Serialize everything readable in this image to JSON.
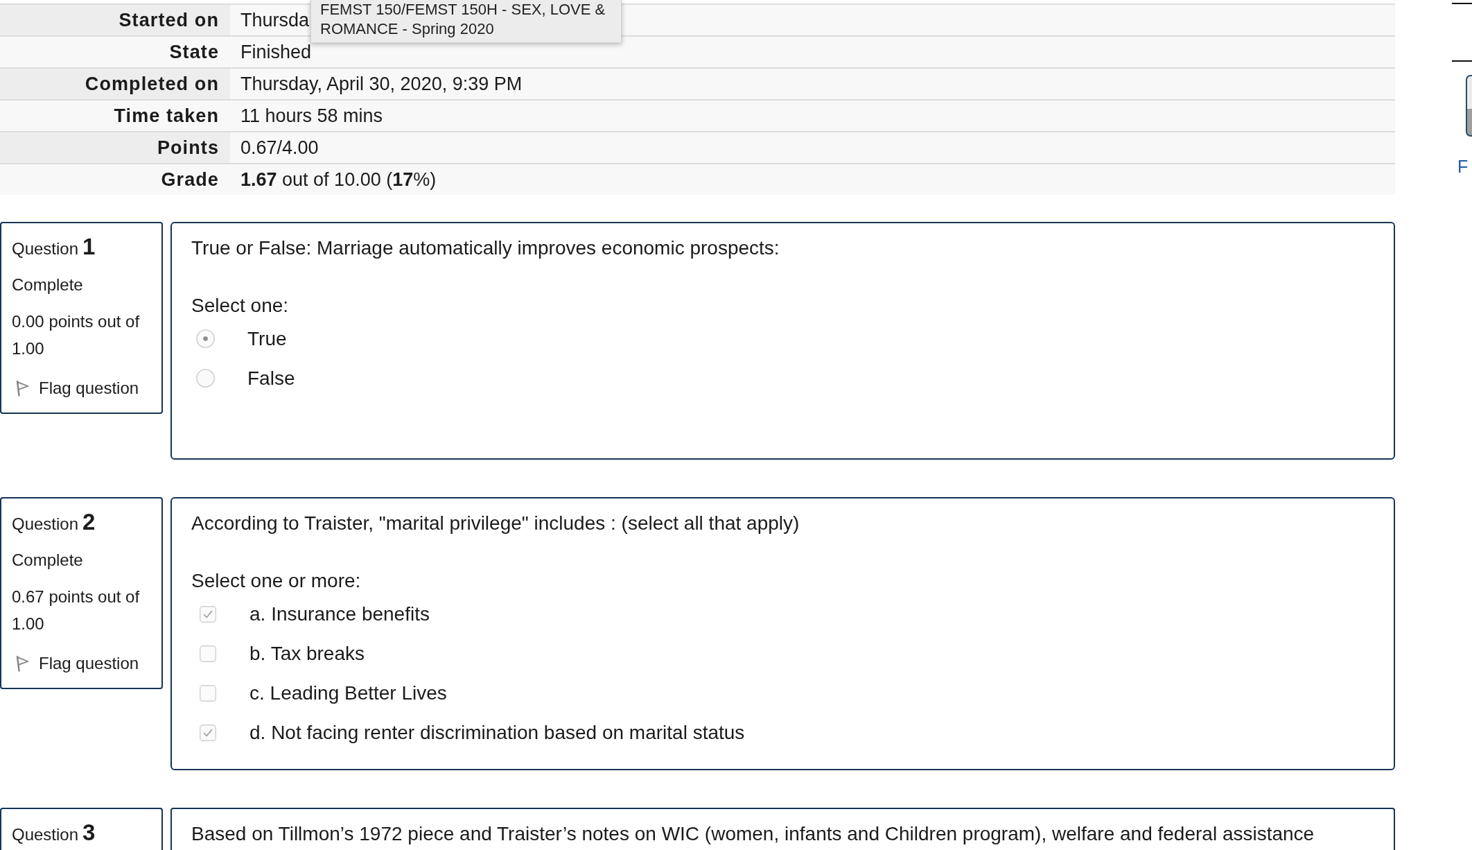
{
  "tooltip": {
    "text": "FEMST 150/FEMST 150H - SEX, LOVE & ROMANCE - Spring 2020"
  },
  "summary": [
    {
      "label": "Started on",
      "value": "Thursda"
    },
    {
      "label": "State",
      "value": "Finished"
    },
    {
      "label": "Completed on",
      "value": "Thursday, April 30, 2020, 9:39 PM"
    },
    {
      "label": "Time taken",
      "value": "11 hours 58 mins"
    },
    {
      "label": "Points",
      "value": "0.67/4.00"
    },
    {
      "label": "Grade",
      "value": "**1.67** out of 10.00 (**17**%)"
    }
  ],
  "questions": [
    {
      "label": "Question",
      "number": "1",
      "state": "Complete",
      "grade": "0.00 points out of 1.00",
      "flag": "Flag question",
      "text": "True or False: Marriage automatically improves economic prospects:",
      "prompt": "Select one:",
      "kind": "radio",
      "options": [
        {
          "label": "True",
          "selected": true
        },
        {
          "label": "False",
          "selected": false
        }
      ]
    },
    {
      "label": "Question",
      "number": "2",
      "state": "Complete",
      "grade": "0.67 points out of 1.00",
      "flag": "Flag question",
      "text": "According to Traister, \"marital privilege\" includes : (select all that apply)",
      "prompt": "Select one or more:",
      "kind": "checkbox",
      "options": [
        {
          "label": "a. Insurance benefits",
          "checked": true
        },
        {
          "label": "b. Tax breaks",
          "checked": false
        },
        {
          "label": "c. Leading Better Lives",
          "checked": false
        },
        {
          "label": "d. Not facing renter discrimination based on marital status",
          "checked": true
        }
      ]
    },
    {
      "label": "Question",
      "number": "3",
      "text": "Based on Tillmon’s 1972 piece and Traister’s notes on WIC (women, infants and Children program), welfare and federal assistance"
    }
  ],
  "sidebar": {
    "link": "F"
  }
}
